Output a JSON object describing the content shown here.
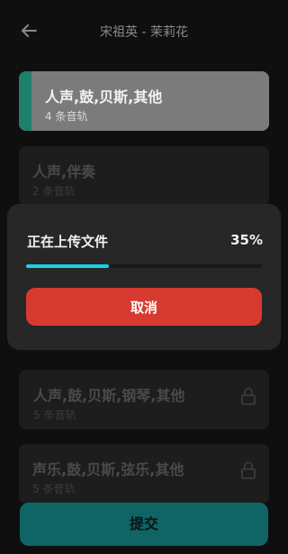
{
  "header": {
    "back_icon": "arrow-left-icon",
    "title": "宋祖英 - 茉莉花"
  },
  "tracks": [
    {
      "name": "人声,鼓,贝斯,其他",
      "count": "4 条音轨",
      "selected": true,
      "locked": false
    },
    {
      "name": "人声,伴奏",
      "count": "2 条音轨",
      "selected": false,
      "locked": false
    },
    {
      "name": "人声,鼓,贝斯,钢琴,其他",
      "count": "5 条音轨",
      "selected": false,
      "locked": true
    },
    {
      "name": "声乐,鼓,贝斯,弦乐,其他",
      "count": "5 条音轨",
      "selected": false,
      "locked": true
    }
  ],
  "upload_dialog": {
    "label": "正在上传文件",
    "percent_text": "35%",
    "progress": 0.35,
    "cancel_label": "取消",
    "progress_color": "#19d2e4",
    "cancel_color": "#d63a30"
  },
  "footer": {
    "submit_label": "提交",
    "submit_color": "#0f6466"
  },
  "colors": {
    "background": "#0f0f0f",
    "selected_accent": "#1e7f6b"
  }
}
